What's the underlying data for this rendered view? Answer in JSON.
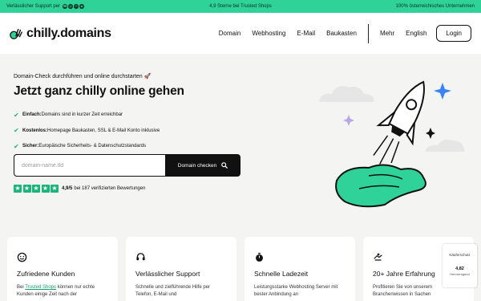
{
  "topbar": {
    "left": "Verlässlicher Support per",
    "center": "4,9 Sterne bei Trusted Shops",
    "right": "100% österreichisches Unternehmen"
  },
  "header": {
    "logo": "chilly.domains",
    "nav": [
      "Domain",
      "Webhosting",
      "E-Mail",
      "Baukasten",
      "Mehr",
      "English"
    ],
    "login": "Login"
  },
  "hero": {
    "pretitle": "Domain-Check durchführen und online durchstarten 🚀",
    "title": "Jetzt ganz chilly online gehen",
    "features": [
      {
        "bold": "Einfach:",
        "text": " Domains sind in kurzer Zeit erreichbar"
      },
      {
        "bold": "Kostenlos:",
        "text": " Homepage Baukasten, SSL & E-Mail Konto inklusive"
      },
      {
        "bold": "Sicher:",
        "text": " Europäische Sicherheits- & Datenschutzstandards"
      }
    ],
    "search_placeholder": "domain-name.tld",
    "search_button": "Domain checken",
    "rating_value": "4,9/5",
    "rating_text": "bei 187 verifizierten Bewertungen"
  },
  "rating_fraction": 0.98,
  "cards": [
    {
      "icon": "smiley-icon",
      "title": "Zufriedene Kunden",
      "text_pre": "Bei ",
      "link": "Trusted Shops",
      "text_post": " können nur echte Kunden einige Zeit nach der"
    },
    {
      "icon": "headset-icon",
      "title": "Verlässlicher Support",
      "text_pre": "Schnelle und zielführende Hilfe per Telefon, E-Mail und",
      "link": "",
      "text_post": ""
    },
    {
      "icon": "stopwatch-icon",
      "title": "Schnelle Ladezeit",
      "text_pre": "Leistungsstarke Webhosting Server mit bester Anbindung an",
      "link": "",
      "text_post": ""
    },
    {
      "icon": "handshake-icon",
      "title": "20+ Jahre Erfahrung",
      "text_pre": "Profitieren Sie von unserem Branchenwissen in Sachen",
      "link": "",
      "text_post": ""
    }
  ],
  "badge": {
    "title": "Käuferschutz",
    "value": "4,82",
    "label": "Hervorragend"
  },
  "colors": {
    "accent": "#2fd39a",
    "star": "#1bb57c",
    "dark": "#111111"
  }
}
